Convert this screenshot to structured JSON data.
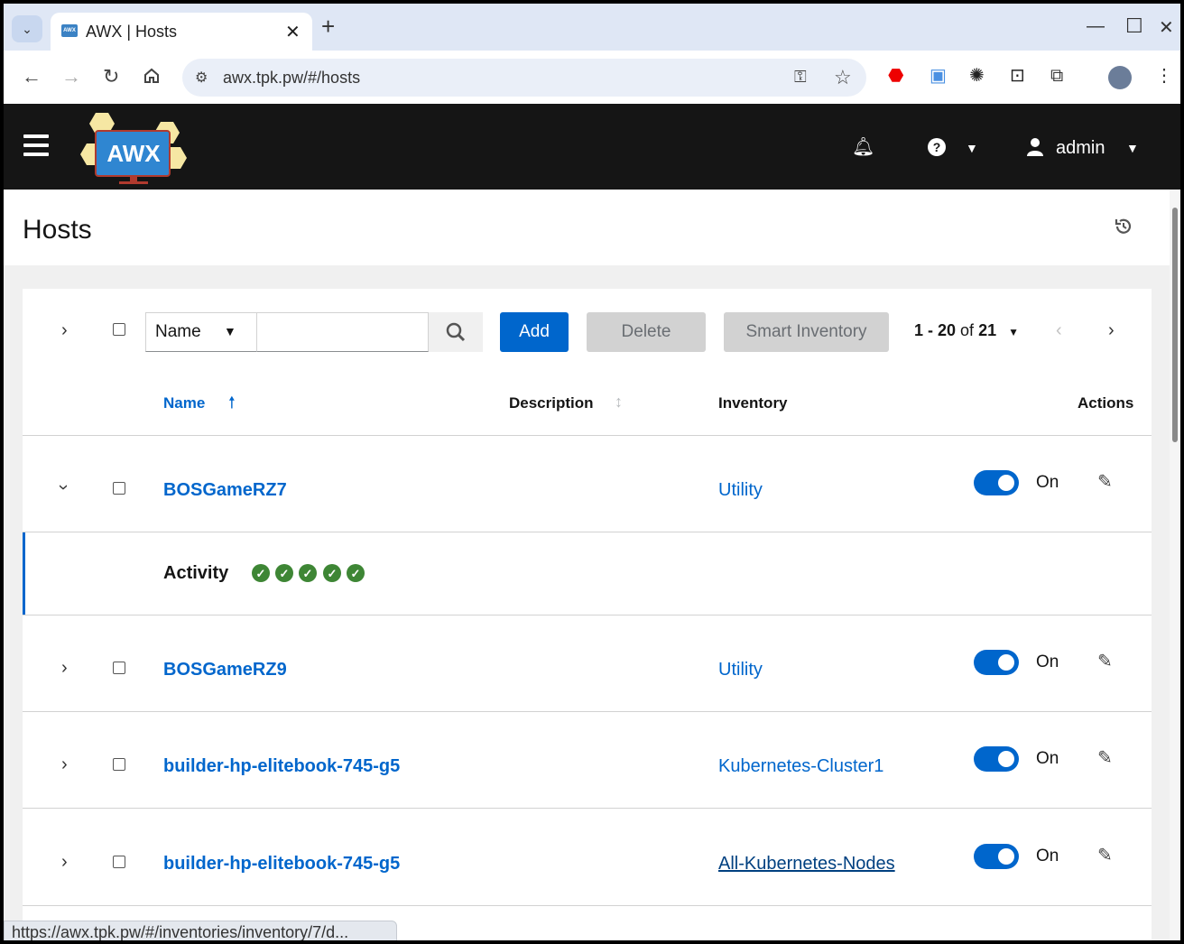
{
  "browser": {
    "tab_title": "AWX | Hosts",
    "tab_favicon_text": "AWX",
    "url": "awx.tpk.pw/#/hosts",
    "status_url": "https://awx.tpk.pw/#/inventories/inventory/7/d..."
  },
  "header": {
    "logo_text": "AWX",
    "user": "admin"
  },
  "page": {
    "title": "Hosts"
  },
  "toolbar": {
    "filter_field": "Name",
    "search_placeholder": "",
    "add_label": "Add",
    "delete_label": "Delete",
    "smart_inventory_label": "Smart Inventory",
    "pagination_range": "1 - 20",
    "pagination_of": "of",
    "pagination_total": "21"
  },
  "table": {
    "columns": {
      "name": "Name",
      "description": "Description",
      "inventory": "Inventory",
      "actions": "Actions"
    },
    "rows": [
      {
        "name": "BOSGameRZ7",
        "inventory": "Utility",
        "enabled_label": "On",
        "expanded": true
      },
      {
        "name": "BOSGameRZ9",
        "inventory": "Utility",
        "enabled_label": "On",
        "expanded": false
      },
      {
        "name": "builder-hp-elitebook-745-g5",
        "inventory": "Kubernetes-Cluster1",
        "enabled_label": "On",
        "expanded": false
      },
      {
        "name": "builder-hp-elitebook-745-g5",
        "inventory": "All-Kubernetes-Nodes",
        "enabled_label": "On",
        "expanded": false
      }
    ],
    "activity_label": "Activity",
    "activity_statuses": [
      "success",
      "success",
      "success",
      "success",
      "success"
    ]
  },
  "colors": {
    "primary": "#0066cc",
    "header_bg": "#151515",
    "success": "#3e8635"
  }
}
